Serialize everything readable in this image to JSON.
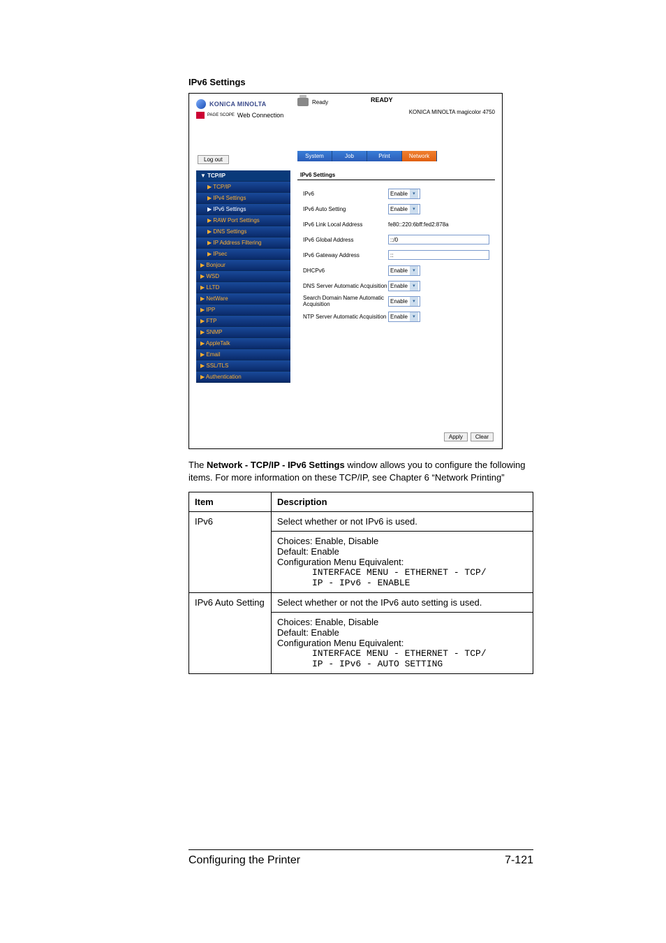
{
  "heading": "IPv6 Settings",
  "screenshot": {
    "brand": "KONICA MINOLTA",
    "pagescope_small": "PAGE SCOPE",
    "pagescope": "Web Connection",
    "status_label": "Ready",
    "ready": "READY",
    "model": "KONICA MINOLTA magicolor 4750",
    "logout": "Log out",
    "tabs": {
      "system": "System",
      "job": "Job",
      "print": "Print",
      "network": "Network"
    },
    "sidebar": {
      "head": "▼ TCP/IP",
      "items": [
        "▶ TCP/IP",
        "▶ IPv4 Settings",
        "▶ IPv6 Settings",
        "▶ RAW Port Settings",
        "▶ DNS Settings",
        "▶ IP Address Filtering",
        "▶ IPsec",
        "▶ Bonjour",
        "▶ WSD",
        "▶ LLTD",
        "▶ NetWare",
        "▶ IPP",
        "▶ FTP",
        "▶ SNMP",
        "▶ AppleTalk",
        "▶ Email",
        "▶ SSL/TLS",
        "▶ Authentication"
      ]
    },
    "form": {
      "title": "IPv6 Settings",
      "rows": [
        {
          "label": "IPv6",
          "type": "select",
          "value": "Enable"
        },
        {
          "label": "IPv6 Auto Setting",
          "type": "select",
          "value": "Enable"
        },
        {
          "label": "IPv6 Link Local Address",
          "type": "text",
          "value": "fe80::220:6bff:fed2:878a"
        },
        {
          "label": "IPv6 Global Address",
          "type": "input",
          "value": "::/0"
        },
        {
          "label": "IPv6 Gateway Address",
          "type": "input",
          "value": "::"
        },
        {
          "label": "DHCPv6",
          "type": "select",
          "value": "Enable"
        },
        {
          "label": "DNS Server Automatic Acquisition",
          "type": "select",
          "value": "Enable"
        },
        {
          "label": "Search Domain Name Automatic Acquisition",
          "type": "select",
          "value": "Enable"
        },
        {
          "label": "NTP Server Automatic Acquisition",
          "type": "select",
          "value": "Enable"
        }
      ],
      "apply": "Apply",
      "clear": "Clear"
    }
  },
  "body_text": {
    "pre": "The ",
    "bold": "Network - TCP/IP - IPv6 Settings",
    "post": " window allows you to configure the following items. For more information on these TCP/IP, see Chapter 6 “Network Printing”"
  },
  "table": {
    "head": {
      "item": "Item",
      "desc": "Description"
    },
    "rows": [
      {
        "item": "IPv6",
        "line1": "Select whether or not IPv6 is used.",
        "choices": "Choices: Enable, Disable",
        "default": "Default:  Enable",
        "cfg": "Configuration Menu Equivalent:",
        "mono1": "INTERFACE MENU - ETHERNET - TCP/",
        "mono2": "IP - IPv6 - ENABLE"
      },
      {
        "item": "IPv6 Auto Setting",
        "line1": "Select whether or not the IPv6 auto setting is used.",
        "choices": "Choices: Enable, Disable",
        "default": "Default:  Enable",
        "cfg": "Configuration Menu Equivalent:",
        "mono1": "INTERFACE MENU - ETHERNET - TCP/",
        "mono2": "IP - IPv6 - AUTO SETTING"
      }
    ]
  },
  "footer": {
    "left": "Configuring the Printer",
    "right": "7-121"
  }
}
